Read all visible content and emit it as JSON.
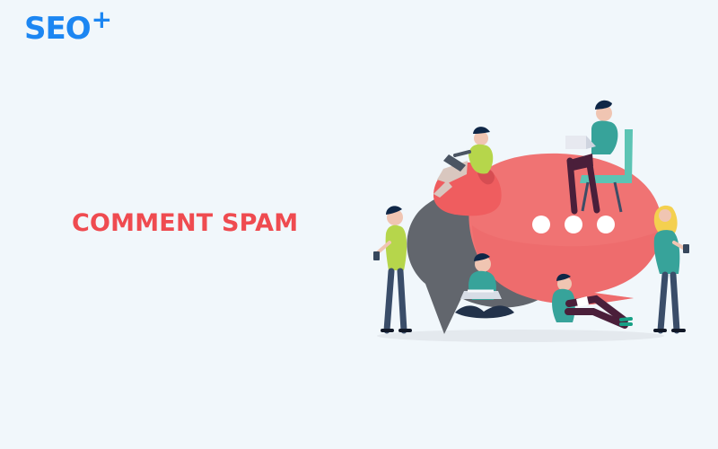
{
  "brand": {
    "name": "SEO",
    "suffix": "+"
  },
  "headline": "COMMENT SPAM",
  "colors": {
    "background": "#f1f7fb",
    "brand": "#1c86f2",
    "headline": "#ef4b50",
    "bubble_main": "#f07373",
    "bubble_dark": "#62666d",
    "shirt_green": "#b6d64b",
    "shirt_teal": "#37a39a"
  },
  "illustration": {
    "bubble_main": "speech-bubble-red",
    "bubble_back": "speech-bubble-gray",
    "bubble_dots": "typing-dots",
    "people": [
      "person-on-beanbag",
      "person-with-laptop-on-chair",
      "person-standing-with-phone-left",
      "person-sitting-crosslegged-with-laptop",
      "person-sitting-reading",
      "person-standing-with-phone-right"
    ]
  }
}
